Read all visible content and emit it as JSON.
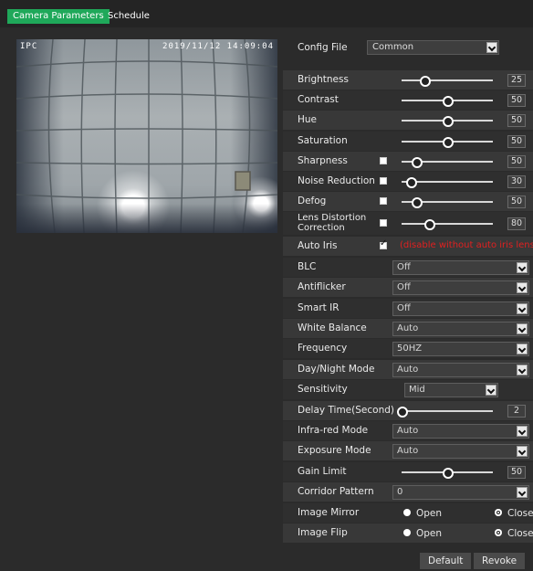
{
  "tabs": [
    {
      "label": "Camera Parameters",
      "active": true
    },
    {
      "label": "Schedule",
      "active": false
    }
  ],
  "preview": {
    "name": "IPC",
    "timestamp": "2019/11/12 14:09:04"
  },
  "config_file": {
    "label": "Config File",
    "value": "Common"
  },
  "params": {
    "brightness": {
      "label": "Brightness",
      "value": "25",
      "level": 25
    },
    "contrast": {
      "label": "Contrast",
      "value": "50",
      "level": 50
    },
    "hue": {
      "label": "Hue",
      "value": "50",
      "level": 50
    },
    "saturation": {
      "label": "Saturation",
      "value": "50",
      "level": 50
    },
    "sharpness": {
      "label": "Sharpness",
      "checked": false,
      "value": "50",
      "level": 16
    },
    "noise_reduction": {
      "label": "Noise Reduction",
      "checked": false,
      "value": "30",
      "level": 10
    },
    "defog": {
      "label": "Defog",
      "checked": false,
      "value": "50",
      "level": 16
    },
    "lens_distortion": {
      "label_line1": "Lens Distortion",
      "label_line2": "Correction",
      "checked": false,
      "value": "80",
      "level": 30
    },
    "auto_iris": {
      "label": "Auto Iris",
      "checked": true,
      "note": "(disable without auto iris lens)"
    },
    "blc": {
      "label": "BLC",
      "value": "Off"
    },
    "antiflicker": {
      "label": "Antiflicker",
      "value": "Off"
    },
    "smart_ir": {
      "label": "Smart IR",
      "value": "Off"
    },
    "white_balance": {
      "label": "White Balance",
      "value": "Auto"
    },
    "frequency": {
      "label": "Frequency",
      "value": "50HZ"
    },
    "day_night_mode": {
      "label": "Day/Night Mode",
      "value": "Auto"
    },
    "sensitivity": {
      "label": "Sensitivity",
      "value": "Mid"
    },
    "delay_time": {
      "label": "Delay Time(Second)",
      "value": "2",
      "level": 0
    },
    "infrared_mode": {
      "label": "Infra-red Mode",
      "value": "Auto"
    },
    "exposure_mode": {
      "label": "Exposure Mode",
      "value": "Auto"
    },
    "gain_limit": {
      "label": "Gain Limit",
      "value": "50",
      "level": 50
    },
    "corridor_pattern": {
      "label": "Corridor Pattern",
      "value": "0"
    },
    "image_mirror": {
      "label": "Image Mirror",
      "open": "Open",
      "close": "Close",
      "selected": "Close"
    },
    "image_flip": {
      "label": "Image Flip",
      "open": "Open",
      "close": "Close",
      "selected": "Close"
    }
  },
  "buttons": {
    "default": "Default",
    "revoke": "Revoke"
  },
  "colors": {
    "accent": "#1fa85a",
    "warning": "#e02020",
    "background": "#2b2b2b"
  }
}
